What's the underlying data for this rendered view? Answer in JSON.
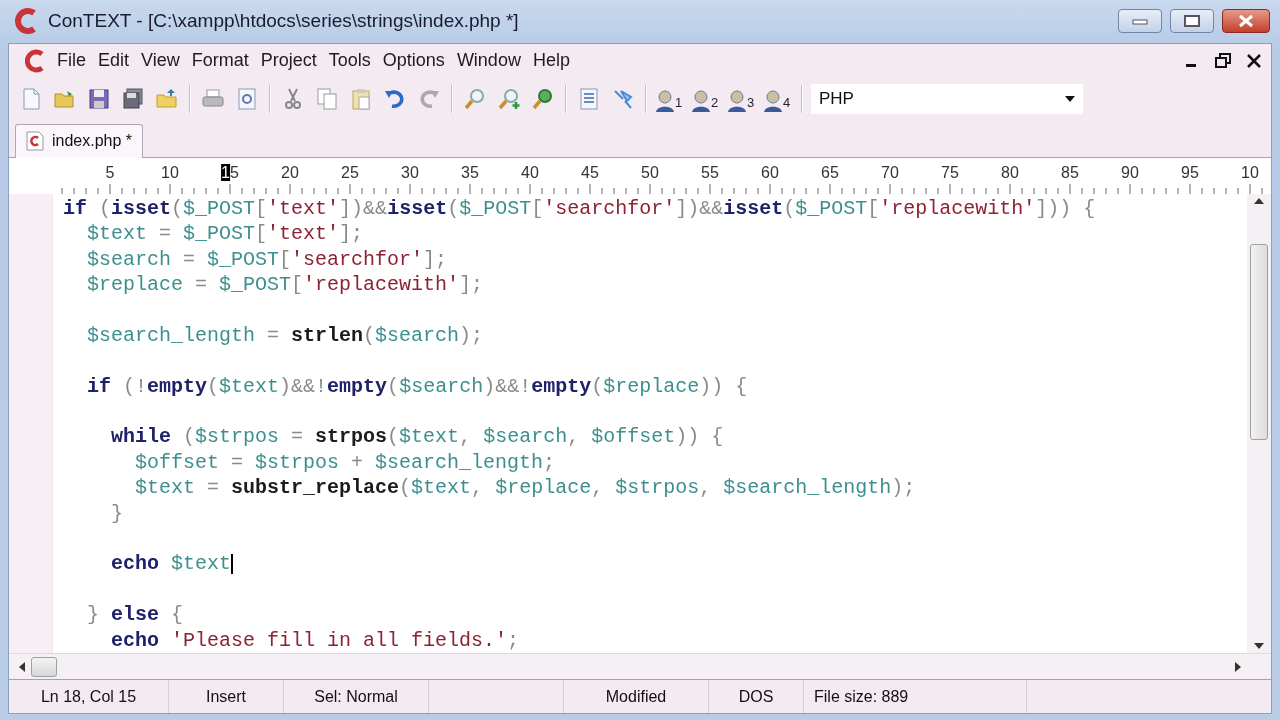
{
  "window": {
    "title": "ConTEXT - [C:\\xampp\\htdocs\\series\\strings\\index.php *]"
  },
  "menu": [
    "File",
    "Edit",
    "View",
    "Format",
    "Project",
    "Tools",
    "Options",
    "Window",
    "Help"
  ],
  "toolbar": [
    {
      "kind": "new"
    },
    {
      "kind": "open"
    },
    {
      "kind": "save"
    },
    {
      "kind": "saveall"
    },
    {
      "kind": "folder"
    },
    {
      "kind": "sep"
    },
    {
      "kind": "print"
    },
    {
      "kind": "preview"
    },
    {
      "kind": "sep"
    },
    {
      "kind": "cut"
    },
    {
      "kind": "copy"
    },
    {
      "kind": "paste"
    },
    {
      "kind": "undo"
    },
    {
      "kind": "redo"
    },
    {
      "kind": "sep"
    },
    {
      "kind": "find"
    },
    {
      "kind": "findnext"
    },
    {
      "kind": "replace"
    },
    {
      "kind": "sep"
    },
    {
      "kind": "doc"
    },
    {
      "kind": "pin"
    },
    {
      "kind": "sep"
    },
    {
      "kind": "user",
      "label": "1"
    },
    {
      "kind": "user",
      "label": "2"
    },
    {
      "kind": "user",
      "label": "3"
    },
    {
      "kind": "user",
      "label": "4"
    },
    {
      "kind": "sep"
    }
  ],
  "highlighter": {
    "value": "PHP"
  },
  "tabs": [
    {
      "label": "index.php *",
      "selected": true
    }
  ],
  "ruler": [
    {
      "text": "5",
      "selected": false
    },
    {
      "text": "10",
      "selected": false
    },
    {
      "text": "15",
      "selected": true
    },
    {
      "text": "20",
      "selected": false
    },
    {
      "text": "25",
      "selected": false
    },
    {
      "text": "30",
      "selected": false
    },
    {
      "text": "35",
      "selected": false
    },
    {
      "text": "40",
      "selected": false
    },
    {
      "text": "45",
      "selected": false
    },
    {
      "text": "50",
      "selected": false
    },
    {
      "text": "55",
      "selected": false
    },
    {
      "text": "60",
      "selected": false
    },
    {
      "text": "65",
      "selected": false
    },
    {
      "text": "70",
      "selected": false
    },
    {
      "text": "75",
      "selected": false
    },
    {
      "text": "80",
      "selected": false
    },
    {
      "text": "85",
      "selected": false
    },
    {
      "text": "90",
      "selected": false
    },
    {
      "text": "95",
      "selected": false
    },
    {
      "text": "10",
      "selected": false
    }
  ],
  "code": [
    {
      "kind": "code",
      "cursor": false,
      "tokens": [
        {
          "kind": "kw",
          "text": "if"
        },
        {
          "kind": "op",
          "text": " ("
        },
        {
          "kind": "kw",
          "text": "isset"
        },
        {
          "kind": "op",
          "text": "("
        },
        {
          "kind": "var",
          "text": "$_POST"
        },
        {
          "kind": "op",
          "text": "["
        },
        {
          "kind": "str",
          "text": "'text'"
        },
        {
          "kind": "op",
          "text": "])&&"
        },
        {
          "kind": "kw",
          "text": "isset"
        },
        {
          "kind": "op",
          "text": "("
        },
        {
          "kind": "var",
          "text": "$_POST"
        },
        {
          "kind": "op",
          "text": "["
        },
        {
          "kind": "str",
          "text": "'searchfor'"
        },
        {
          "kind": "op",
          "text": "])&&"
        },
        {
          "kind": "kw",
          "text": "isset"
        },
        {
          "kind": "op",
          "text": "("
        },
        {
          "kind": "var",
          "text": "$_POST"
        },
        {
          "kind": "op",
          "text": "["
        },
        {
          "kind": "str",
          "text": "'replacewith'"
        },
        {
          "kind": "op",
          "text": "])) {"
        }
      ]
    },
    {
      "kind": "code",
      "cursor": false,
      "tokens": [
        {
          "kind": "var",
          "text": "  $text"
        },
        {
          "kind": "op",
          "text": " = "
        },
        {
          "kind": "var",
          "text": "$_POST"
        },
        {
          "kind": "op",
          "text": "["
        },
        {
          "kind": "str",
          "text": "'text'"
        },
        {
          "kind": "op",
          "text": "];"
        }
      ]
    },
    {
      "kind": "code",
      "cursor": false,
      "tokens": [
        {
          "kind": "var",
          "text": "  $search"
        },
        {
          "kind": "op",
          "text": " = "
        },
        {
          "kind": "var",
          "text": "$_POST"
        },
        {
          "kind": "op",
          "text": "["
        },
        {
          "kind": "str",
          "text": "'searchfor'"
        },
        {
          "kind": "op",
          "text": "];"
        }
      ]
    },
    {
      "kind": "code",
      "cursor": false,
      "tokens": [
        {
          "kind": "var",
          "text": "  $replace"
        },
        {
          "kind": "op",
          "text": " = "
        },
        {
          "kind": "var",
          "text": "$_POST"
        },
        {
          "kind": "op",
          "text": "["
        },
        {
          "kind": "str",
          "text": "'replacewith'"
        },
        {
          "kind": "op",
          "text": "];"
        }
      ]
    },
    {
      "kind": "blank"
    },
    {
      "kind": "code",
      "cursor": false,
      "tokens": [
        {
          "kind": "var",
          "text": "  $search_length"
        },
        {
          "kind": "op",
          "text": " = "
        },
        {
          "kind": "fn",
          "text": "strlen"
        },
        {
          "kind": "op",
          "text": "("
        },
        {
          "kind": "var",
          "text": "$search"
        },
        {
          "kind": "op",
          "text": ");"
        }
      ]
    },
    {
      "kind": "blank"
    },
    {
      "kind": "code",
      "cursor": false,
      "tokens": [
        {
          "kind": "kw",
          "text": "  if"
        },
        {
          "kind": "op",
          "text": " (!"
        },
        {
          "kind": "kw",
          "text": "empty"
        },
        {
          "kind": "op",
          "text": "("
        },
        {
          "kind": "var",
          "text": "$text"
        },
        {
          "kind": "op",
          "text": ")&&!"
        },
        {
          "kind": "kw",
          "text": "empty"
        },
        {
          "kind": "op",
          "text": "("
        },
        {
          "kind": "var",
          "text": "$search"
        },
        {
          "kind": "op",
          "text": ")&&!"
        },
        {
          "kind": "kw",
          "text": "empty"
        },
        {
          "kind": "op",
          "text": "("
        },
        {
          "kind": "var",
          "text": "$replace"
        },
        {
          "kind": "op",
          "text": ")) {"
        }
      ]
    },
    {
      "kind": "blank"
    },
    {
      "kind": "code",
      "cursor": false,
      "tokens": [
        {
          "kind": "kw",
          "text": "    while"
        },
        {
          "kind": "op",
          "text": " ("
        },
        {
          "kind": "var",
          "text": "$strpos"
        },
        {
          "kind": "op",
          "text": " = "
        },
        {
          "kind": "fn",
          "text": "strpos"
        },
        {
          "kind": "op",
          "text": "("
        },
        {
          "kind": "var",
          "text": "$text"
        },
        {
          "kind": "op",
          "text": ", "
        },
        {
          "kind": "var",
          "text": "$search"
        },
        {
          "kind": "op",
          "text": ", "
        },
        {
          "kind": "var",
          "text": "$offset"
        },
        {
          "kind": "op",
          "text": ")) {"
        }
      ]
    },
    {
      "kind": "code",
      "cursor": false,
      "tokens": [
        {
          "kind": "var",
          "text": "      $offset"
        },
        {
          "kind": "op",
          "text": " = "
        },
        {
          "kind": "var",
          "text": "$strpos"
        },
        {
          "kind": "op",
          "text": " + "
        },
        {
          "kind": "var",
          "text": "$search_length"
        },
        {
          "kind": "op",
          "text": ";"
        }
      ]
    },
    {
      "kind": "code",
      "cursor": false,
      "tokens": [
        {
          "kind": "var",
          "text": "      $text"
        },
        {
          "kind": "op",
          "text": " = "
        },
        {
          "kind": "fn",
          "text": "substr_replace"
        },
        {
          "kind": "op",
          "text": "("
        },
        {
          "kind": "var",
          "text": "$text"
        },
        {
          "kind": "op",
          "text": ", "
        },
        {
          "kind": "var",
          "text": "$replace"
        },
        {
          "kind": "op",
          "text": ", "
        },
        {
          "kind": "var",
          "text": "$strpos"
        },
        {
          "kind": "op",
          "text": ", "
        },
        {
          "kind": "var",
          "text": "$search_length"
        },
        {
          "kind": "op",
          "text": ");"
        }
      ]
    },
    {
      "kind": "code",
      "cursor": false,
      "tokens": [
        {
          "kind": "op",
          "text": "    }"
        }
      ]
    },
    {
      "kind": "blank"
    },
    {
      "kind": "code",
      "cursor": true,
      "tokens": [
        {
          "kind": "kw",
          "text": "    echo"
        },
        {
          "kind": "var",
          "text": " $text"
        }
      ]
    },
    {
      "kind": "blank"
    },
    {
      "kind": "code",
      "cursor": false,
      "tokens": [
        {
          "kind": "op",
          "text": "  } "
        },
        {
          "kind": "kw",
          "text": "else"
        },
        {
          "kind": "op",
          "text": " {"
        }
      ]
    },
    {
      "kind": "code",
      "cursor": false,
      "tokens": [
        {
          "kind": "kw",
          "text": "    echo"
        },
        {
          "kind": "str",
          "text": " 'Please fill in all fields.'"
        },
        {
          "kind": "op",
          "text": ";"
        }
      ]
    }
  ],
  "status_bar": [
    "Ln 18, Col 15",
    "Insert",
    "Sel: Normal",
    "Modified",
    "DOS",
    "File size: 889"
  ]
}
